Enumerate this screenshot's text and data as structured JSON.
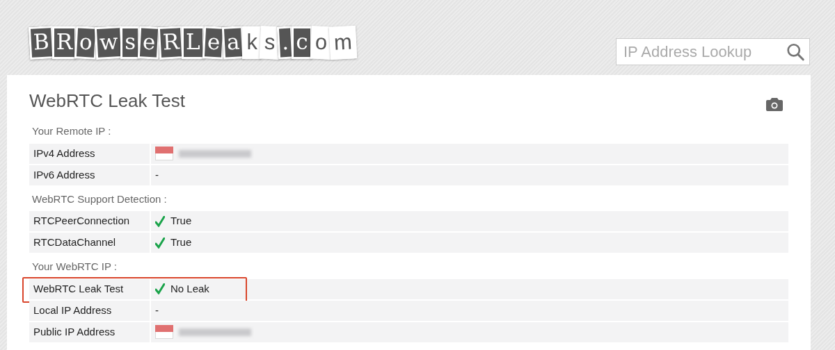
{
  "logo": {
    "text": "BRowseRLeaks.com"
  },
  "search": {
    "placeholder": "IP Address Lookup"
  },
  "panel": {
    "title": "WebRTC Leak Test"
  },
  "sections": [
    {
      "heading": "Your Remote IP :",
      "rows": [
        {
          "label": "IPv4 Address",
          "kind": "ip",
          "highlighted": false
        },
        {
          "label": "IPv6 Address",
          "kind": "text",
          "value": "-",
          "highlighted": false
        }
      ]
    },
    {
      "heading": "WebRTC Support Detection :",
      "rows": [
        {
          "label": "RTCPeerConnection",
          "kind": "check",
          "value": "True",
          "highlighted": false
        },
        {
          "label": "RTCDataChannel",
          "kind": "check",
          "value": "True",
          "highlighted": false
        }
      ]
    },
    {
      "heading": "Your WebRTC IP :",
      "rows": [
        {
          "label": "WebRTC Leak Test",
          "kind": "check",
          "value": "No Leak",
          "highlighted": true
        },
        {
          "label": "Local IP Address",
          "kind": "text",
          "value": "-",
          "highlighted": false
        },
        {
          "label": "Public IP Address",
          "kind": "ip",
          "highlighted": false
        }
      ]
    }
  ]
}
